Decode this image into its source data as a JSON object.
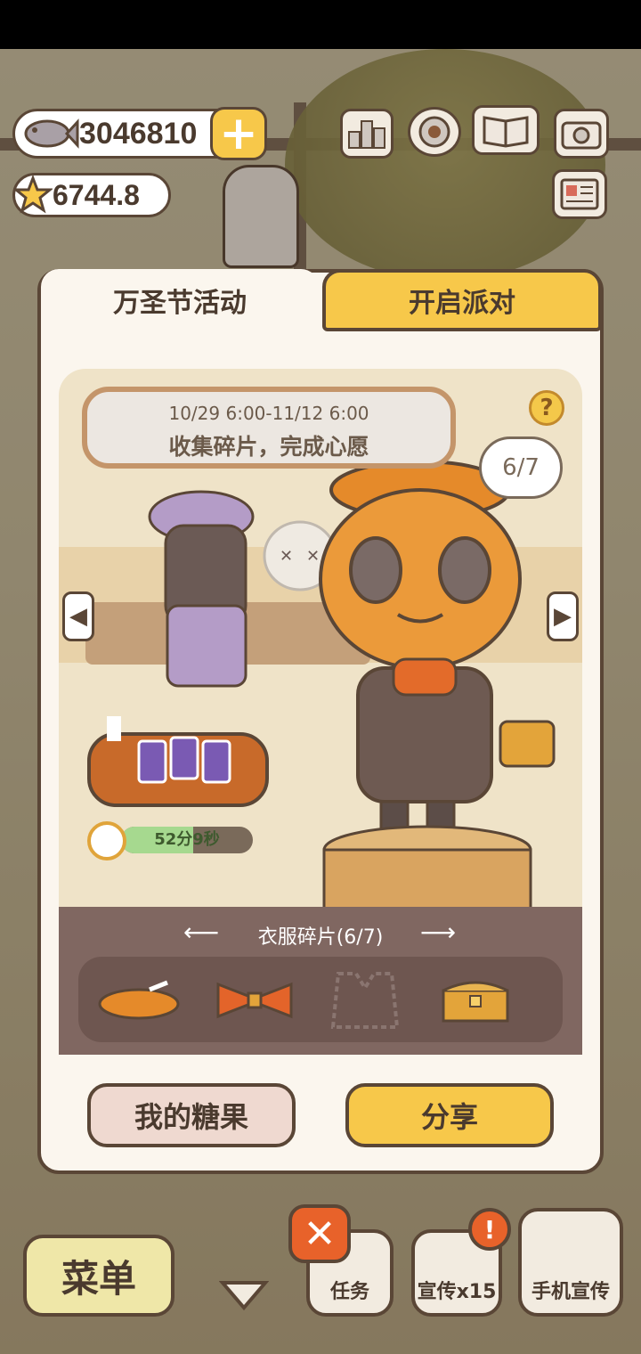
{
  "currency": {
    "fish_value": "3046810",
    "star_value": "6744.8"
  },
  "tabs": [
    {
      "label": "万圣节活动"
    },
    {
      "label": "开启派对"
    }
  ],
  "event": {
    "date_range": "10/29 6:00-11/12 6:00",
    "subtitle": "收集碎片，完成心愿",
    "progress_bubble": "6/7",
    "timer_text": "52分9秒",
    "timer_fraction": 0.55
  },
  "pieces": {
    "title": "衣服碎片(6/7)",
    "items": [
      {
        "icon": "beret-icon"
      },
      {
        "icon": "bowtie-icon"
      },
      {
        "icon": "vest-icon"
      },
      {
        "icon": "treasure-chest-icon"
      }
    ]
  },
  "buttons": {
    "my_candy": "我的糖果",
    "share": "分享"
  },
  "bottom_bar": {
    "menu": "菜单",
    "tasks": "任务",
    "promote": "宣传x15",
    "phone_promote": "手机宣传"
  },
  "colors": {
    "accent_yellow": "#f7c84a",
    "panel_bg": "#fbf6ee",
    "outline": "#5a4636",
    "close_orange": "#e8622a"
  }
}
